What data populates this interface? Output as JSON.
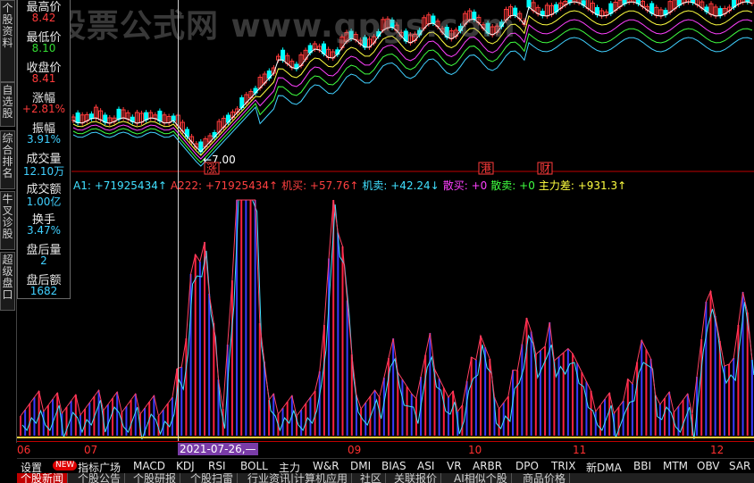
{
  "watermark": "股票公式网 www.gpgs.com",
  "left_tabs": [
    "个股资料",
    "自选股",
    "综合排名",
    "牛叉诊股",
    "超级盘口"
  ],
  "info_panel": {
    "rows": [
      {
        "label": "最高价",
        "value": "8.42",
        "color": "#ff3b3b"
      },
      {
        "label": "最低价",
        "value": "8.10",
        "color": "#33dd33"
      },
      {
        "label": "收盘价",
        "value": "8.41",
        "color": "#ff3b3b"
      },
      {
        "label": "涨幅",
        "value": "+2.81%",
        "color": "#ff3b3b"
      },
      {
        "label": "振幅",
        "value": "3.91%",
        "color": "#40d0ff"
      },
      {
        "label": "成交量",
        "value": "12.10万",
        "color": "#40d0ff"
      },
      {
        "label": "成交额",
        "value": "1.00亿",
        "color": "#40d0ff"
      },
      {
        "label": "换手",
        "value": "3.47%",
        "color": "#40d0ff"
      },
      {
        "label": "盘后量",
        "value": "2",
        "color": "#40d0ff"
      },
      {
        "label": "盘后额",
        "value": "1682",
        "color": "#40d0ff"
      }
    ]
  },
  "price_chart": {
    "low_marker": "7.00",
    "events": [
      "涨",
      "港",
      "财"
    ]
  },
  "indicator_bar": [
    {
      "text": "A1: +71925434↑",
      "color": "#40e0ff"
    },
    {
      "text": "A222: +71925434↑",
      "color": "#ff4040"
    },
    {
      "text": "机买: +57.76↑",
      "color": "#ff4040"
    },
    {
      "text": "机卖: +42.24↓",
      "color": "#40e0ff"
    },
    {
      "text": "散买: +0",
      "color": "#ff40ff"
    },
    {
      "text": "散卖: +0",
      "color": "#40ff40"
    },
    {
      "text": "主力差: +931.3↑",
      "color": "#ffff40"
    }
  ],
  "time_axis": {
    "labels": [
      "06",
      "07",
      "09",
      "10",
      "11",
      "12"
    ],
    "selected_date": "2021-07-26,—"
  },
  "indicator_tabs": [
    "设置",
    "指标广场",
    "MACD",
    "KDJ",
    "RSI",
    "BOLL",
    "主力",
    "W&R",
    "DMI",
    "BIAS",
    "ASI",
    "VR",
    "ARBR",
    "DPO",
    "TRIX",
    "新DMA",
    "BBI",
    "MTM",
    "OBV",
    "SAR"
  ],
  "new_badge": "NEW",
  "info_tabs": [
    "个股新闻",
    "个股公告",
    "个股研报",
    "个股扫雷",
    "行业资讯|计算机应用",
    "社区",
    "关联报价",
    "AI相似个股",
    "商品价格"
  ],
  "colors": {
    "up": "#ff3b3b",
    "down": "#00ffff",
    "accent": "#c00000"
  }
}
